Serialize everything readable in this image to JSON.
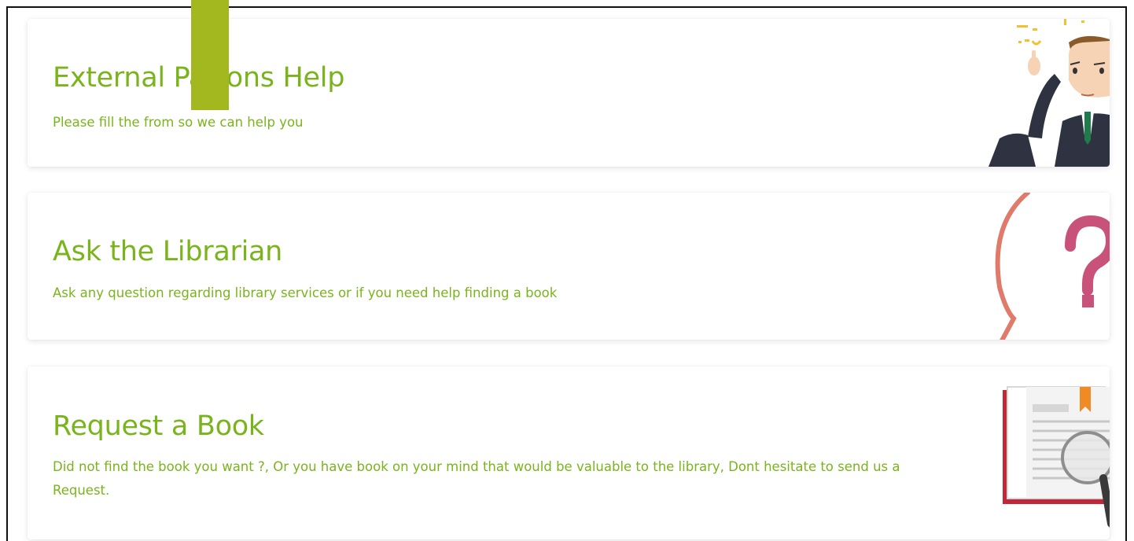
{
  "cards": [
    {
      "title": "External Patrons Help",
      "description": "Please fill the from so we can help you",
      "icon": "businessman-thinking-icon"
    },
    {
      "title": "Ask the Librarian",
      "description": "Ask any question regarding library services or if you need help finding a book",
      "icon": "question-bubble-icon"
    },
    {
      "title": "Request a Book",
      "description": "Did not find the book you want ?, Or you have book on your mind that would be valuable to the library, Dont hesitate to send us a Request.",
      "icon": "book-magnifier-icon"
    }
  ],
  "colors": {
    "accent_green": "#7ab41c",
    "bar_green": "#a3b81e",
    "question_pink": "#c9527a",
    "bubble_salmon": "#e07a6a",
    "book_red": "#c0283a",
    "bookmark_orange": "#f08a24"
  }
}
